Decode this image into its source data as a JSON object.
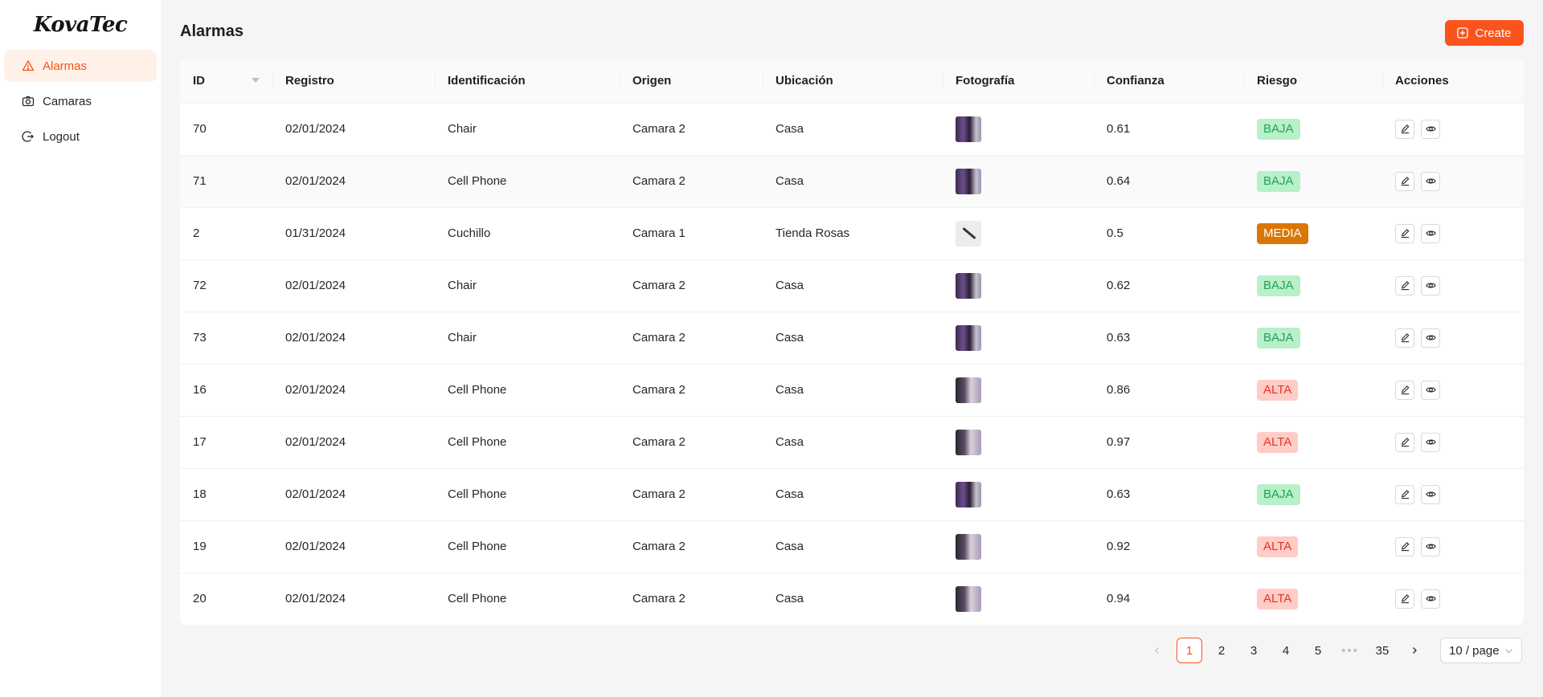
{
  "app": {
    "logo": "KovaTec"
  },
  "sidebar": {
    "items": [
      {
        "label": "Alarmas",
        "icon": "warning-icon",
        "active": true
      },
      {
        "label": "Camaras",
        "icon": "camera-icon",
        "active": false
      },
      {
        "label": "Logout",
        "icon": "logout-icon",
        "active": false
      }
    ]
  },
  "header": {
    "title": "Alarmas",
    "create_label": "Create"
  },
  "table": {
    "columns": [
      "ID",
      "Registro",
      "Identificación",
      "Origen",
      "Ubicación",
      "Fotografía",
      "Confianza",
      "Riesgo",
      "Acciones"
    ],
    "rows": [
      {
        "id": "70",
        "registro": "02/01/2024",
        "identificacion": "Chair",
        "origen": "Camara 2",
        "ubicacion": "Casa",
        "foto": "chair",
        "confianza": "0.61",
        "riesgo": "BAJA"
      },
      {
        "id": "71",
        "registro": "02/01/2024",
        "identificacion": "Cell Phone",
        "origen": "Camara 2",
        "ubicacion": "Casa",
        "foto": "chair",
        "confianza": "0.64",
        "riesgo": "BAJA"
      },
      {
        "id": "2",
        "registro": "01/31/2024",
        "identificacion": "Cuchillo",
        "origen": "Camara 1",
        "ubicacion": "Tienda Rosas",
        "foto": "knife",
        "confianza": "0.5",
        "riesgo": "MEDIA"
      },
      {
        "id": "72",
        "registro": "02/01/2024",
        "identificacion": "Chair",
        "origen": "Camara 2",
        "ubicacion": "Casa",
        "foto": "chair",
        "confianza": "0.62",
        "riesgo": "BAJA"
      },
      {
        "id": "73",
        "registro": "02/01/2024",
        "identificacion": "Chair",
        "origen": "Camara 2",
        "ubicacion": "Casa",
        "foto": "chair",
        "confianza": "0.63",
        "riesgo": "BAJA"
      },
      {
        "id": "16",
        "registro": "02/01/2024",
        "identificacion": "Cell Phone",
        "origen": "Camara 2",
        "ubicacion": "Casa",
        "foto": "phone",
        "confianza": "0.86",
        "riesgo": "ALTA"
      },
      {
        "id": "17",
        "registro": "02/01/2024",
        "identificacion": "Cell Phone",
        "origen": "Camara 2",
        "ubicacion": "Casa",
        "foto": "phone",
        "confianza": "0.97",
        "riesgo": "ALTA"
      },
      {
        "id": "18",
        "registro": "02/01/2024",
        "identificacion": "Cell Phone",
        "origen": "Camara 2",
        "ubicacion": "Casa",
        "foto": "chair",
        "confianza": "0.63",
        "riesgo": "BAJA"
      },
      {
        "id": "19",
        "registro": "02/01/2024",
        "identificacion": "Cell Phone",
        "origen": "Camara 2",
        "ubicacion": "Casa",
        "foto": "phone",
        "confianza": "0.92",
        "riesgo": "ALTA"
      },
      {
        "id": "20",
        "registro": "02/01/2024",
        "identificacion": "Cell Phone",
        "origen": "Camara 2",
        "ubicacion": "Casa",
        "foto": "phone",
        "confianza": "0.94",
        "riesgo": "ALTA"
      }
    ]
  },
  "pagination": {
    "pages": [
      "1",
      "2",
      "3",
      "4",
      "5"
    ],
    "ellipsis": "•••",
    "last": "35",
    "current": "1",
    "page_size": "10 / page"
  },
  "colors": {
    "accent": "#fa541c",
    "baja": "#23a05b",
    "media": "#d97706",
    "alta": "#e5322b"
  }
}
